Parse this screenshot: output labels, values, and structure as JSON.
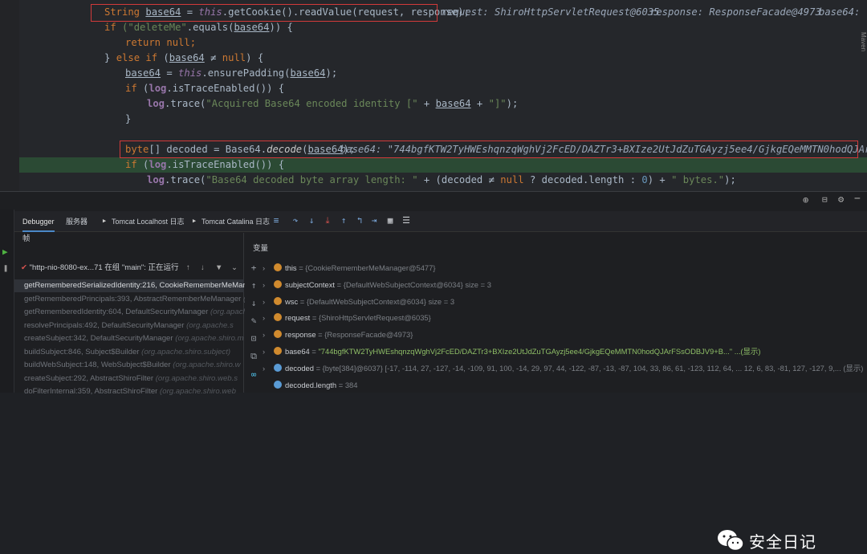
{
  "editor": {
    "line1_decl": "String ",
    "line1_var": "base64",
    "line1_eq": " = ",
    "line1_this": "this",
    "line1_call": ".getCookie().readValue(request, response);",
    "line1_hint1": "request: ShiroHttpServletRequest@6035",
    "line1_hint2": "response: ResponseFacade@4973",
    "line1_hint3": "base64:",
    "line2_if": "if",
    "line2_str": "(\"deleteMe\"",
    "line2_rest": ".equals(",
    "line2_var": "base64",
    "line2_end": ")) {",
    "line3_return": "return",
    "line3_null": " null;",
    "line4_close": "} ",
    "line4_else": "else if",
    "line4_open": " (",
    "line4_var": "base64",
    "line4_ne": " ≠ ",
    "line4_null": "null",
    "line4_end": ") {",
    "line5_var": "base64",
    "line5_eq": " = ",
    "line5_this": "this",
    "line5_call": ".ensurePadding(",
    "line5_arg": "base64",
    "line5_end": ");",
    "line6_if": "if",
    "line6_open": " (",
    "line6_log": "log",
    "line6_call": ".isTraceEnabled()) {",
    "line7_log": "log",
    "line7_call": ".trace(",
    "line7_str": "\"Acquired Base64 encoded identity [\"",
    "line7_plus": " + ",
    "line7_var": "base64",
    "line7_plus2": " + ",
    "line7_str2": "\"]\"",
    "line7_end": ");",
    "line8_close": "}",
    "line10_type": "byte",
    "line10_decl": "[] decoded = Base64.",
    "line10_call": "decode",
    "line10_open": "(",
    "line10_arg": "base64",
    "line10_end": ");",
    "line10_hint": "base64: \"744bgfKTW2TyHWEshqnzqWghVj2FcED/DAZTr3+BXIze2UtJdZuTGAyzj5ee4/GjkgEQeMMTN0hodQJArFSsODBJV9",
    "line11_if": "if",
    "line11_open": " (",
    "line11_log": "log",
    "line11_call": ".isTraceEnabled()) {",
    "line12_log": "log",
    "line12_call": ".trace(",
    "line12_str": "\"Base64 decoded byte array length: \"",
    "line12_rest": " + (decoded ≠ ",
    "line12_null": "null",
    "line12_rest2": " ? decoded.length : ",
    "line12_zero": "0",
    "line12_rest3": ") + ",
    "line12_str2": "\" bytes.\"",
    "line12_end": ");"
  },
  "tabs": {
    "debugger": "Debugger",
    "servers": "服务器",
    "tomcat_localhost": "Tomcat Localhost 日志",
    "tomcat_catalina": "Tomcat Catalina 日志"
  },
  "frames": {
    "header": "帧",
    "thread": "\"http-nio-8080-ex...71 在组 \"main\": 正在运行",
    "items": [
      {
        "method": "getRememberedSerializedIdentity:216, CookieRememberMeMana",
        "cls": ""
      },
      {
        "method": "getRememberedPrincipals:393, AbstractRememberMeManager",
        "cls": "(org.apac"
      },
      {
        "method": "getRememberedIdentity:604, DefaultSecurityManager",
        "cls": "(org.apach"
      },
      {
        "method": "resolvePrincipals:492, DefaultSecurityManager",
        "cls": "(org.apache.s"
      },
      {
        "method": "createSubject:342, DefaultSecurityManager",
        "cls": "(org.apache.shiro.m"
      },
      {
        "method": "buildSubject:846, Subject$Builder",
        "cls": "(org.apache.shiro.subject)"
      },
      {
        "method": "buildWebSubject:148, WebSubject$Builder",
        "cls": "(org.apache.shiro.w"
      },
      {
        "method": "createSubject:292, AbstractShiroFilter",
        "cls": "(org.apache.shiro.web.s"
      },
      {
        "method": "doFilterInternal:359, AbstractShiroFilter",
        "cls": "(org.apache.shiro.web"
      }
    ]
  },
  "variables": {
    "header": "变量",
    "items": [
      {
        "name": "this",
        "value": "{CookieRememberMeManager@5477}",
        "icon": "#d08a2e"
      },
      {
        "name": "subjectContext",
        "value": "{DefaultWebSubjectContext@6034}  size = 3",
        "icon": "#d08a2e"
      },
      {
        "name": "wsc",
        "value": "{DefaultWebSubjectContext@6034}  size = 3",
        "icon": "#d08a2e"
      },
      {
        "name": "request",
        "value": "{ShiroHttpServletRequest@6035}",
        "icon": "#d08a2e"
      },
      {
        "name": "response",
        "value": "{ResponseFacade@4973}",
        "icon": "#d08a2e"
      },
      {
        "name": "base64",
        "value": "\"744bgfKTW2TyHWEshqnzqWghVj2FcED/DAZTr3+BXIze2UtJdZuTGAyzj5ee4/GjkgEQeMMTN0hodQJArFSsODBJV9+B...\" ...(显示)",
        "icon": "#d08a2e"
      },
      {
        "name": "decoded",
        "value": "{byte[384]@6037} [-17, -114, 27, -127, -14, -109, 91, 100, -14, 29, 97, 44, -122, -87, -13, -87, 104, 33, 86, 61, -123, 112, 64, ... 12, 6, 83, -81, 127, -127, 9,... (显示)",
        "icon": "#5a9bd5"
      },
      {
        "name": "decoded.length",
        "value": "384",
        "icon": "#5a9bd5"
      }
    ]
  },
  "side_label": "Maven",
  "watermark": "安全日记"
}
